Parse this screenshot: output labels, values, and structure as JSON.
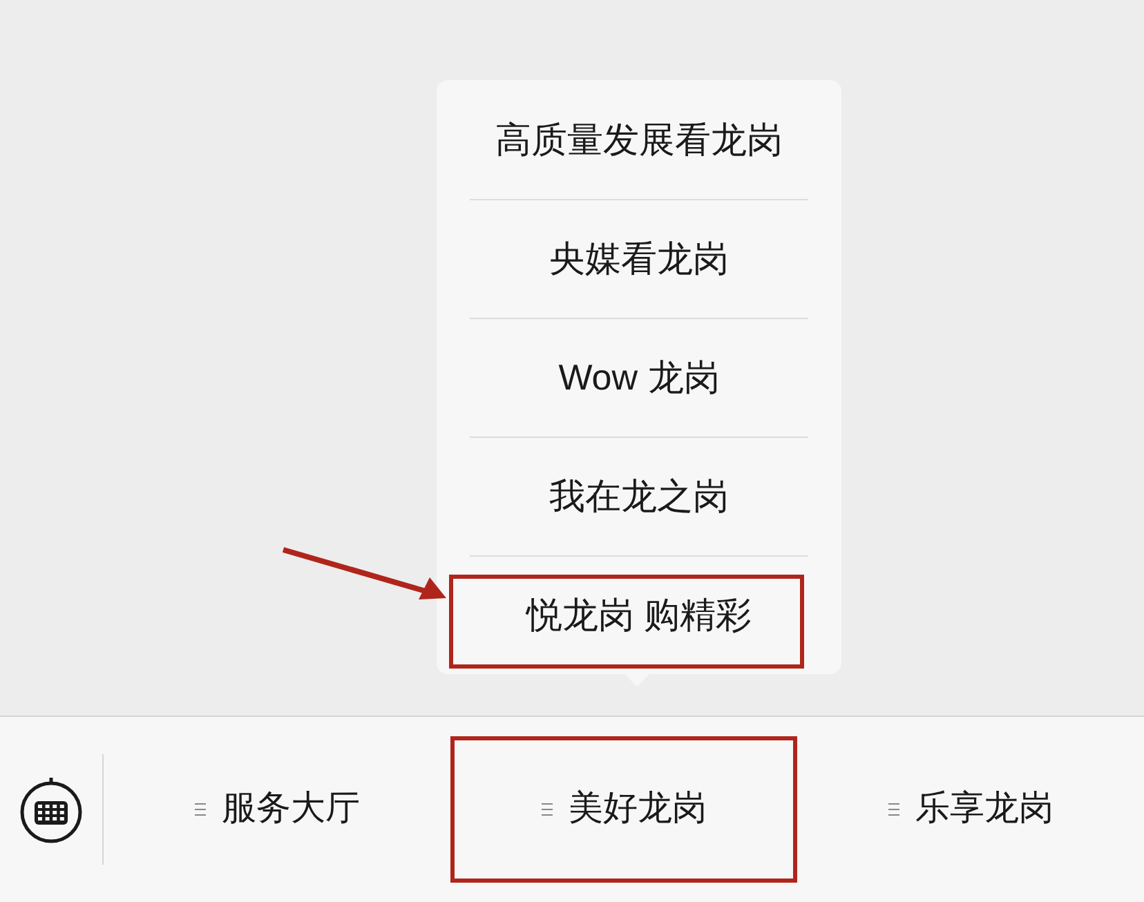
{
  "menu": {
    "items": [
      {
        "label": "高质量发展看龙岗",
        "highlighted": false
      },
      {
        "label": "央媒看龙岗",
        "highlighted": false
      },
      {
        "label": "Wow 龙岗",
        "highlighted": false
      },
      {
        "label": "我在龙之岗",
        "highlighted": false
      },
      {
        "label": "悦龙岗 购精彩",
        "highlighted": true
      }
    ]
  },
  "bottom_bar": {
    "tabs": [
      {
        "label": "服务大厅",
        "highlighted": false
      },
      {
        "label": "美好龙岗",
        "highlighted": true
      },
      {
        "label": "乐享龙岗",
        "highlighted": false
      }
    ]
  }
}
